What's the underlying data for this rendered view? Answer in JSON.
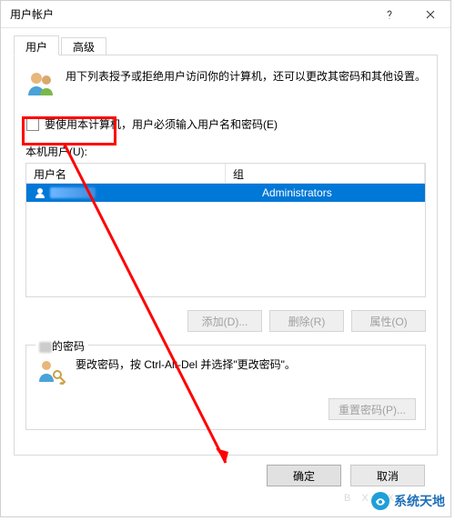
{
  "window": {
    "title": "用户帐户"
  },
  "tabs": {
    "user": "用户",
    "advanced": "高级"
  },
  "intro": "用下列表授予或拒绝用户访问你的计算机，还可以更改其密码和其他设置。",
  "checkbox": {
    "label": "要使用本计算机，用户必须输入用户名和密码(E)"
  },
  "local_users_label": "本机用户(U):",
  "listview": {
    "headers": {
      "username": "用户名",
      "group": "组"
    },
    "rows": [
      {
        "group": "Administrators"
      }
    ]
  },
  "user_buttons": {
    "add": "添加(D)...",
    "remove": "删除(R)",
    "properties": "属性(O)"
  },
  "password_group": {
    "legend_suffix": "的密码",
    "text": "要改密码，按 Ctrl-Alt-Del 并选择\"更改密码\"。",
    "reset": "重置密码(P)..."
  },
  "dialog": {
    "ok": "确定",
    "cancel": "取消"
  },
  "watermark": "系统天地"
}
